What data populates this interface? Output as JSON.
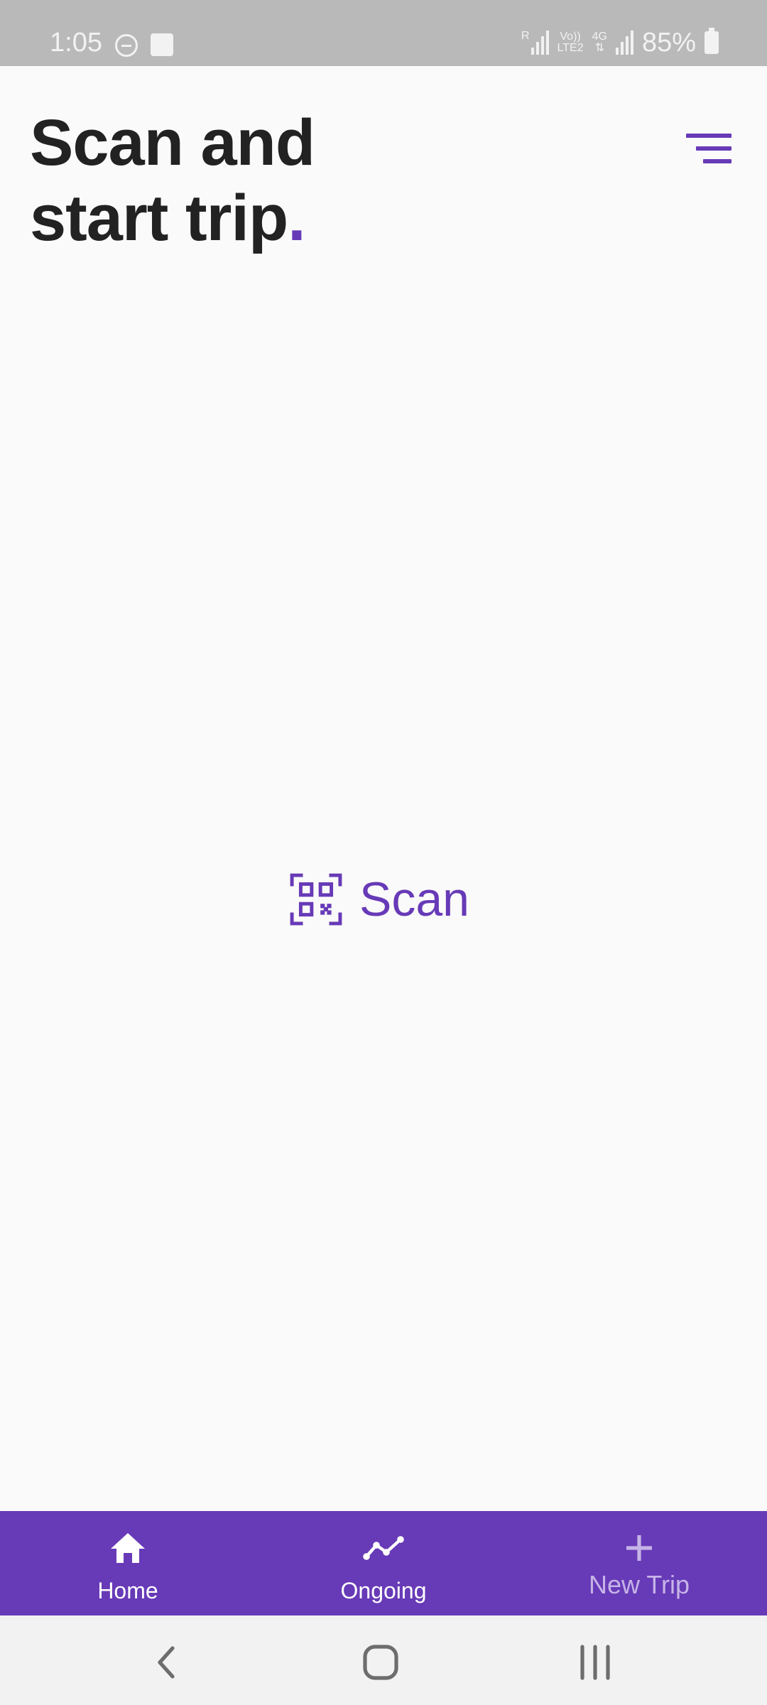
{
  "status_bar": {
    "time": "1:05",
    "network_r": "R",
    "volte": "Vo))",
    "lte": "LTE2",
    "net_type": "4G",
    "battery_percent": "85%"
  },
  "header": {
    "title_line1": "Scan and",
    "title_line2": "start trip",
    "title_dot": "."
  },
  "scan_button": {
    "label": "Scan",
    "icon": "qr-code-scan-icon"
  },
  "bottom_nav": {
    "items": [
      {
        "label": "Home",
        "icon": "home-icon",
        "active": true
      },
      {
        "label": "Ongoing",
        "icon": "trend-line-icon",
        "active": true
      },
      {
        "label": "New Trip",
        "icon": "plus-icon",
        "active": false
      }
    ]
  },
  "system_nav": {
    "back_icon": "back-chevron-icon",
    "home_icon": "home-square-icon",
    "recents_icon": "recents-icon"
  },
  "colors": {
    "accent": "#673ab7",
    "title_text": "#222222",
    "background": "#fafafa",
    "status_bar": "#b9b9b9",
    "inactive_nav_text": "#c6b4e8"
  }
}
